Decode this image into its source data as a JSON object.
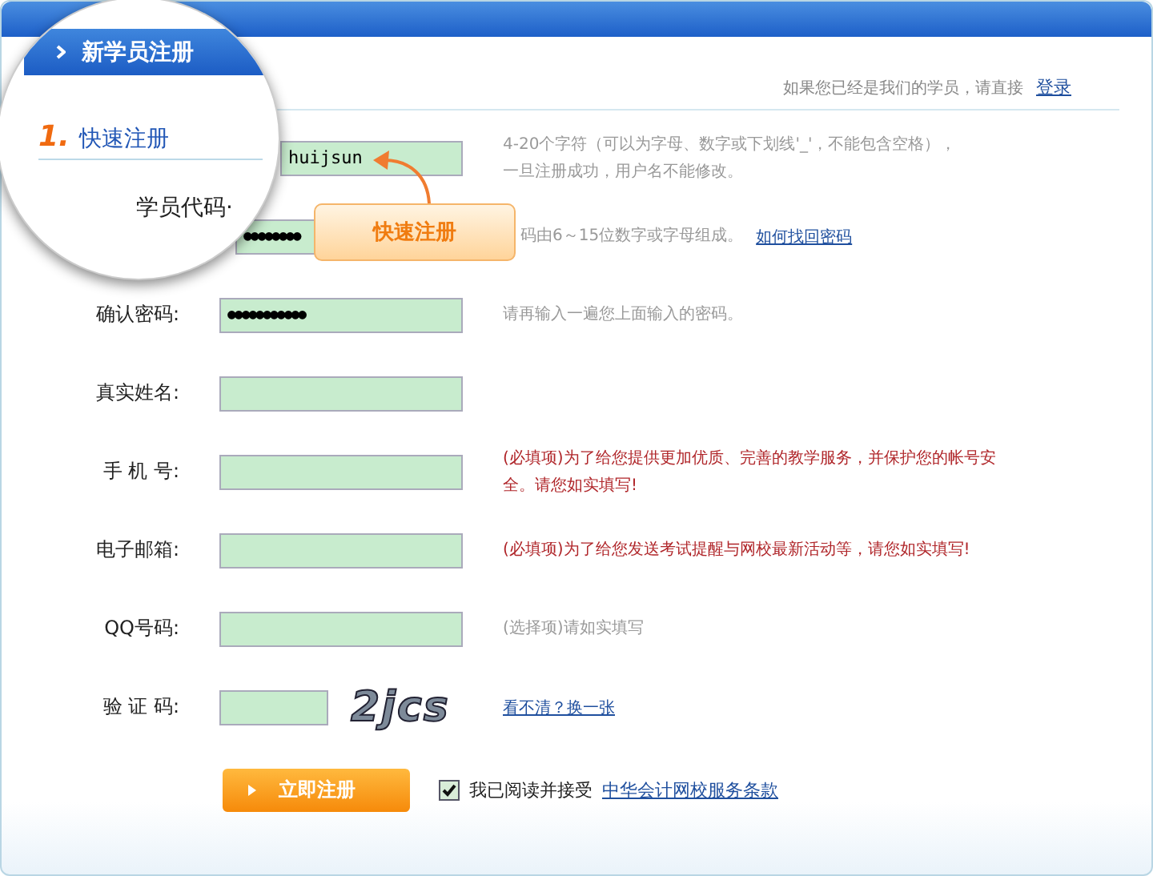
{
  "magnifier": {
    "tab_title": "新学员注册",
    "step_number": "1.",
    "step_title": "快速注册",
    "field_label": "学员代码·"
  },
  "login": {
    "prompt": "如果您已经是我们的学员，请直接",
    "link": "登录"
  },
  "callout": {
    "text": "快速注册"
  },
  "fields": [
    {
      "kind": "text",
      "value": "huijsun",
      "hint": [
        "4-20个字符（可以为字母、数字或下划线'_'，不能包含空格），",
        "一旦注册成功，用户名不能修改。"
      ],
      "required": false
    },
    {
      "kind": "password",
      "value": "●●●●●●●●",
      "hint": [
        "码由6～15位数字或字母组成。"
      ],
      "required": false,
      "link": "如何找回密码"
    },
    {
      "kind": "password",
      "label": "确认密码:",
      "value": "●●●●●●●●●●●",
      "hint": [
        "请再输入一遍您上面输入的密码。"
      ],
      "required": false
    },
    {
      "kind": "text",
      "label": "真实姓名:"
    },
    {
      "kind": "text",
      "label": "手 机 号:",
      "hint": [
        "(必填项)为了给您提供更加优质、完善的教学服务，并保护您的帐号安",
        "全。请您如实填写!"
      ],
      "required": true
    },
    {
      "kind": "text",
      "label": "电子邮箱:",
      "hint": [
        "(必填项)为了给您发送考试提醒与网校最新活动等，请您如实填写!"
      ],
      "required": true
    },
    {
      "kind": "text",
      "label": "QQ号码:",
      "hint": [
        "(选择项)请如实填写"
      ],
      "required": false
    },
    {
      "kind": "captcha",
      "label": "验 证 码:",
      "captcha_text": "2jcs",
      "link": "看不清？换一张"
    }
  ],
  "submit": {
    "label": "立即注册"
  },
  "agreement": {
    "checked": true,
    "text": "我已阅读并接受",
    "link": "中华会计网校服务条款"
  }
}
